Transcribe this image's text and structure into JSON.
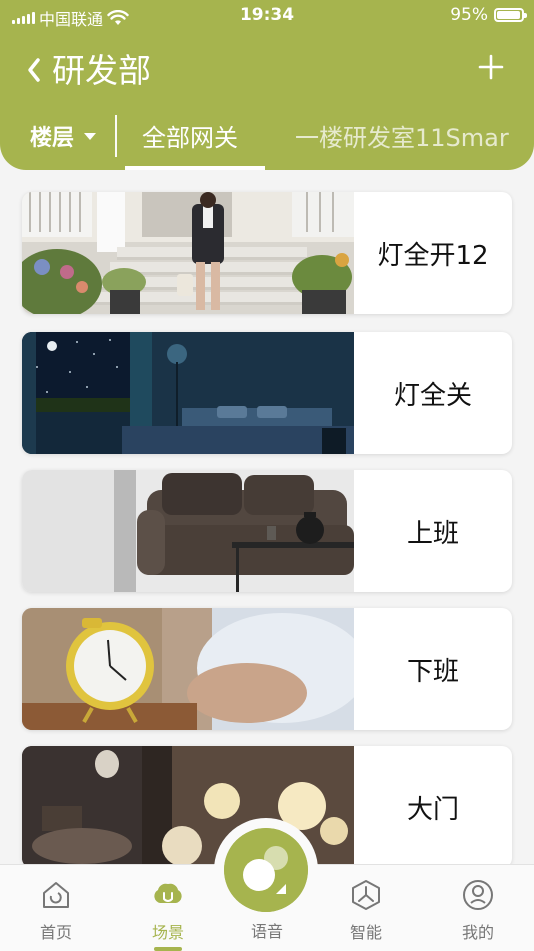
{
  "status": {
    "carrier": "中国联通",
    "time": "19:34",
    "battery": "95%",
    "battery_level": 0.95
  },
  "header": {
    "title": "研发部",
    "floor_label": "楼层",
    "tabs": [
      "全部网关",
      "一楼研发室11Smar"
    ]
  },
  "scenes": [
    {
      "label": "灯全开12"
    },
    {
      "label": "灯全关"
    },
    {
      "label": "上班"
    },
    {
      "label": "下班"
    },
    {
      "label": "大门"
    }
  ],
  "nav": {
    "home": "首页",
    "scene": "场景",
    "voice": "语音",
    "smart": "智能",
    "mine": "我的"
  },
  "colors": {
    "brand": "#a6b44e",
    "inactive": "#777777"
  }
}
